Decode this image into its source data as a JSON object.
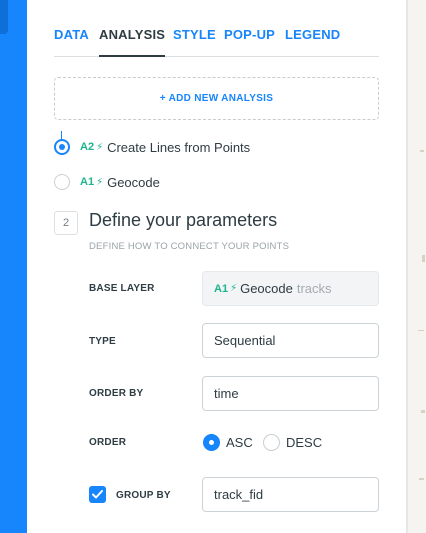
{
  "tabs": {
    "data": "DATA",
    "analysis": "ANALYSIS",
    "style": "STYLE",
    "popup": "POP-UP",
    "legend": "LEGEND",
    "active": "ANALYSIS"
  },
  "add_analysis": {
    "label": "+ ADD NEW ANALYSIS"
  },
  "analyses": [
    {
      "id": "A2",
      "label": "Create Lines from Points",
      "selected": true
    },
    {
      "id": "A1",
      "label": "Geocode",
      "selected": false
    }
  ],
  "step": {
    "number": "2",
    "title": "Define your parameters",
    "subtitle": "DEFINE HOW TO CONNECT YOUR POINTS"
  },
  "form": {
    "base_layer": {
      "label": "BASE LAYER",
      "id": "A1",
      "name": "Geocode",
      "source": "tracks"
    },
    "type": {
      "label": "TYPE",
      "value": "Sequential"
    },
    "order_by": {
      "label": "ORDER BY",
      "value": "time"
    },
    "order": {
      "label": "ORDER",
      "options": [
        "ASC",
        "DESC"
      ],
      "selected": "ASC"
    },
    "group_by": {
      "label": "GROUP BY",
      "checked": true,
      "value": "track_fid"
    }
  },
  "colors": {
    "accent": "#1785fb",
    "analysis_id": "#1cb38e",
    "text": "#2e3c43",
    "muted": "#9aa3a8"
  },
  "icons": {
    "bolt": "lightning-bolt-icon",
    "check": "check-icon"
  }
}
